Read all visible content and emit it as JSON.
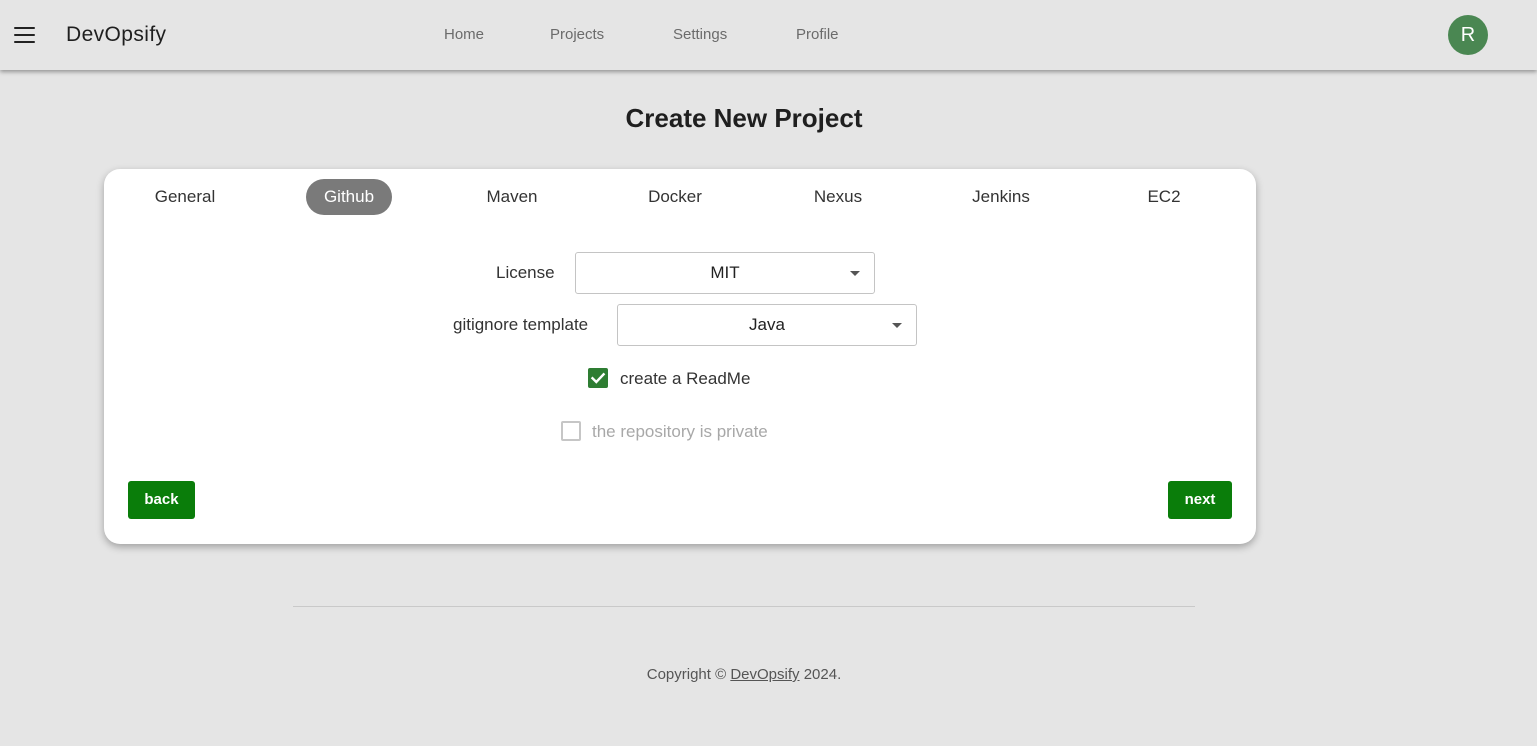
{
  "app": {
    "brand": "DevOpsify",
    "user_initial": "R"
  },
  "nav": {
    "items": [
      "Home",
      "Projects",
      "Settings",
      "Profile"
    ]
  },
  "page": {
    "title": "Create New Project"
  },
  "tabs": {
    "items": [
      "General",
      "Github",
      "Maven",
      "Docker",
      "Nexus",
      "Jenkins",
      "EC2"
    ],
    "active": "Github"
  },
  "form": {
    "license_label": "License",
    "license_value": "MIT",
    "gitignore_label": "gitignore template",
    "gitignore_value": "Java",
    "readme_label": "create a ReadMe",
    "readme_checked": true,
    "private_label": "the repository is private",
    "private_checked": false,
    "private_disabled": true
  },
  "buttons": {
    "back": "back",
    "next": "next"
  },
  "footer": {
    "prefix": "Copyright ©",
    "link": "DevOpsify",
    "suffix": "2024."
  },
  "colors": {
    "background": "#e5e5e5",
    "accent_green": "#0a7d0a",
    "checkbox_green": "#2e7d32",
    "avatar_green": "#4a8752",
    "active_tab": "#7a7a7a"
  }
}
